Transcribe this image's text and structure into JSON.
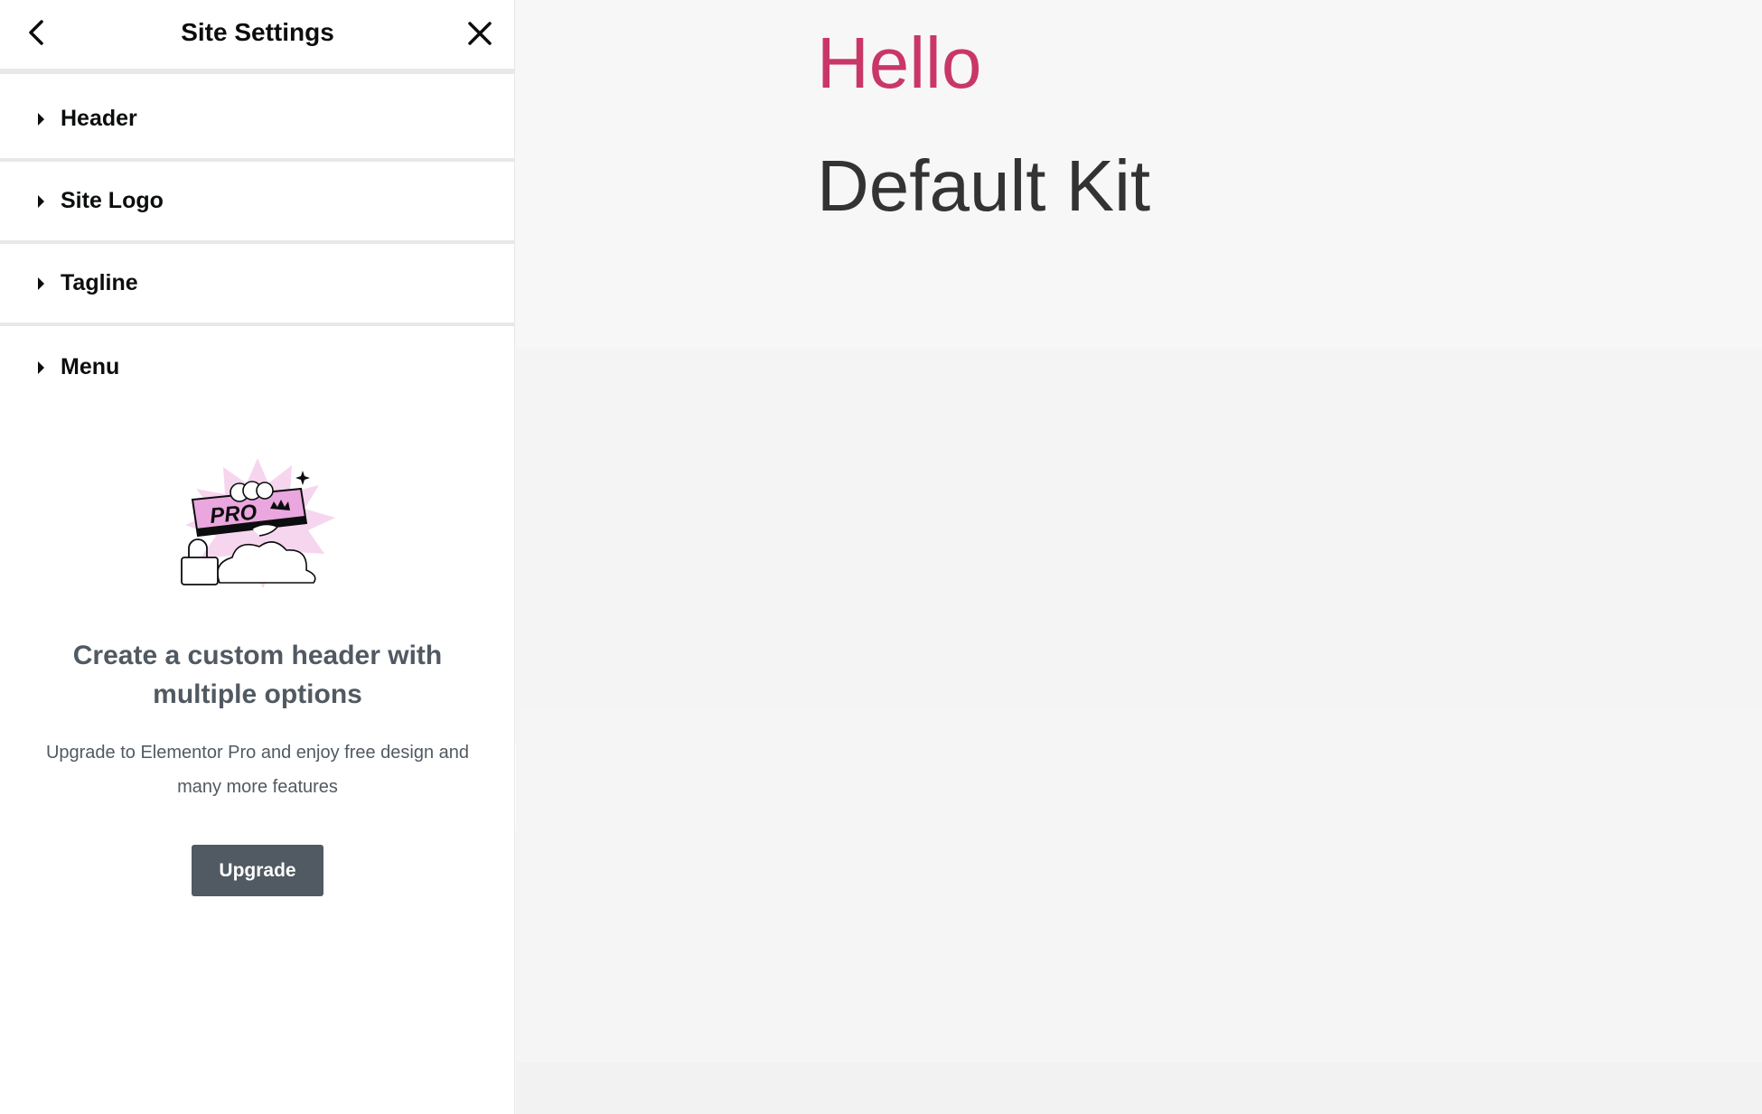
{
  "panel": {
    "title": "Site Settings",
    "back_icon": "chevron-left-icon",
    "close_icon": "close-icon",
    "sections": [
      {
        "label": "Header"
      },
      {
        "label": "Site Logo"
      },
      {
        "label": "Tagline"
      },
      {
        "label": "Menu"
      }
    ]
  },
  "promo": {
    "illustration_text": "PRO",
    "title": "Create a custom header with multiple options",
    "text": "Upgrade to Elementor Pro and enjoy free design and many more features",
    "upgrade_label": "Upgrade"
  },
  "preview": {
    "site_title": "Hello",
    "site_tagline": "Default Kit"
  },
  "colors": {
    "accent_pink": "#c93767",
    "panel_text": "#515962",
    "button_bg": "#515962",
    "preview_bg": "#f8f7f7"
  }
}
